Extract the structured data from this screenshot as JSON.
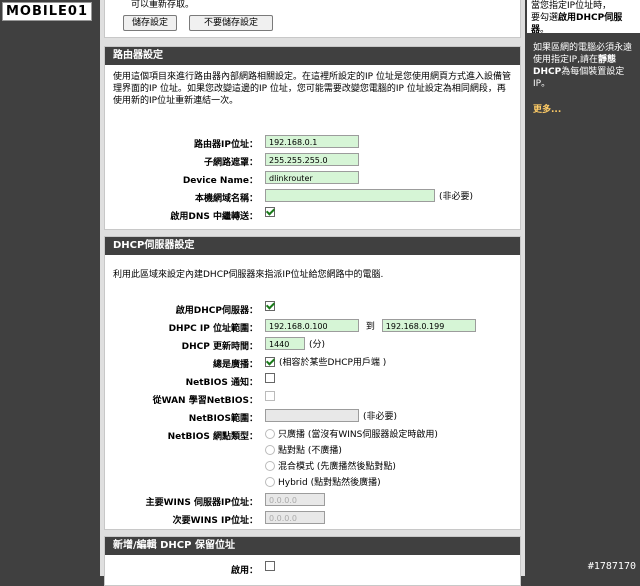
{
  "watermark": "MOBILE01",
  "top": {
    "partial_text": "可以重新存取。",
    "save_button": "儲存設定",
    "nosave_button": "不要儲存設定"
  },
  "side": {
    "box_line1": "當您指定IP位址時，",
    "box_line2_pre": "要勾選",
    "box_line2_bold": "啟用DHCP伺服",
    "box_line3_bold": "器",
    "box_line3_post": "。",
    "text_pre": "如果區網的電腦必須永遠使用指定IP,請在",
    "text_bold": "靜態DHCP",
    "text_post": "為每個裝置設定IP。",
    "more": "更多..."
  },
  "router": {
    "header": "路由器設定",
    "desc": "使用這個項目來進行路由器內部網路相關設定。在這裡所設定的IP 位址是您使用網頁方式進入設備管理界面的IP 位址。如果您改變這邊的IP 位址，您可能需要改變您電腦的IP 位址設定為相同網段，再使用新的IP位址重新連結一次。",
    "ip_label": "路由器IP位址：",
    "ip_value": "192.168.0.1",
    "mask_label": "子網路遮罩：",
    "mask_value": "255.255.255.0",
    "device_label": "Device Name：",
    "device_value": "dlinkrouter",
    "domain_label": "本機網域名稱：",
    "domain_value": "",
    "domain_note": "(非必要)",
    "dns_label": "啟用DNS 中繼轉送："
  },
  "dhcp": {
    "header": "DHCP伺服器設定",
    "desc": "利用此區域來設定內建DHCP伺服器來指派IP位址給您網路中的電腦.",
    "enable_label": "啟用DHCP伺服器：",
    "range_label": "DHPC IP 位址範圍：",
    "range_start": "192.168.0.100",
    "range_to": "到",
    "range_end": "192.168.0.199",
    "lease_label": "DHCP 更新時間：",
    "lease_value": "1440",
    "lease_unit": "(分)",
    "broadcast_label": "總是廣播：",
    "broadcast_note": "(相容於某些DHCP用戶端 )",
    "netbios_label": "NetBIOS 通知：",
    "wan_netbios_label": "從WAN 學習NetBIOS：",
    "scope_label": "NetBIOS範圍：",
    "scope_note": "(非必要)",
    "nodetype_label": "NetBIOS 網點類型：",
    "nodetype_options": [
      "只廣播 (當沒有WINS伺服器設定時啟用)",
      "點對點 (不廣播)",
      "混合模式 (先廣播然後點對點)",
      "Hybrid (點對點然後廣播)"
    ],
    "primary_wins_label": "主要WINS 伺服器IP位址：",
    "primary_wins_value": "0.0.0.0",
    "secondary_wins_label": "次要WINS IP位址：",
    "secondary_wins_value": "0.0.0.0"
  },
  "reserve": {
    "header": "新增/編輯 DHCP 保留位址",
    "enable_label": "啟用："
  },
  "post_id": "#1787170"
}
